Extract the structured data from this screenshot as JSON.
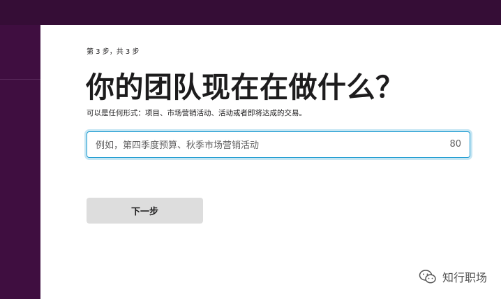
{
  "step_indicator": "第 3 步，共 3 步",
  "title": "你的团队现在在做什么？",
  "subtitle": "可以是任何形式：项目、市场营销活动、活动或者即将达成的交易。",
  "input": {
    "placeholder": "例如，第四季度预算、秋季市场营销活动",
    "value": "",
    "char_counter": "80"
  },
  "next_button": "下一步",
  "watermark": {
    "text": "知行职场",
    "icon": "wechat-icon"
  },
  "colors": {
    "sidebar": "#3f0e40",
    "topbar": "#350d36",
    "focus_border": "#1d9bd1",
    "button_bg": "#dddddd"
  }
}
